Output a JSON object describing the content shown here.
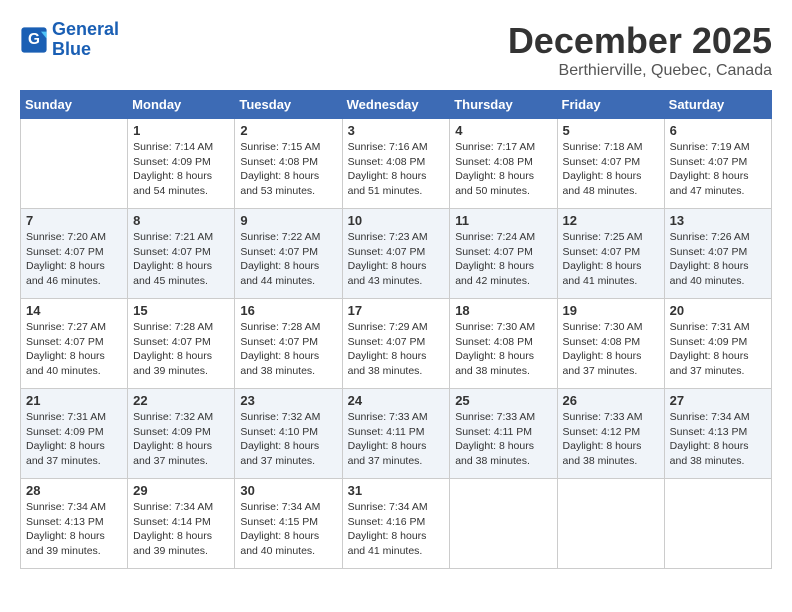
{
  "header": {
    "logo_line1": "General",
    "logo_line2": "Blue",
    "month": "December 2025",
    "location": "Berthierville, Quebec, Canada"
  },
  "weekdays": [
    "Sunday",
    "Monday",
    "Tuesday",
    "Wednesday",
    "Thursday",
    "Friday",
    "Saturday"
  ],
  "weeks": [
    [
      {
        "day": "",
        "sunrise": "",
        "sunset": "",
        "daylight": ""
      },
      {
        "day": "1",
        "sunrise": "Sunrise: 7:14 AM",
        "sunset": "Sunset: 4:09 PM",
        "daylight": "Daylight: 8 hours and 54 minutes."
      },
      {
        "day": "2",
        "sunrise": "Sunrise: 7:15 AM",
        "sunset": "Sunset: 4:08 PM",
        "daylight": "Daylight: 8 hours and 53 minutes."
      },
      {
        "day": "3",
        "sunrise": "Sunrise: 7:16 AM",
        "sunset": "Sunset: 4:08 PM",
        "daylight": "Daylight: 8 hours and 51 minutes."
      },
      {
        "day": "4",
        "sunrise": "Sunrise: 7:17 AM",
        "sunset": "Sunset: 4:08 PM",
        "daylight": "Daylight: 8 hours and 50 minutes."
      },
      {
        "day": "5",
        "sunrise": "Sunrise: 7:18 AM",
        "sunset": "Sunset: 4:07 PM",
        "daylight": "Daylight: 8 hours and 48 minutes."
      },
      {
        "day": "6",
        "sunrise": "Sunrise: 7:19 AM",
        "sunset": "Sunset: 4:07 PM",
        "daylight": "Daylight: 8 hours and 47 minutes."
      }
    ],
    [
      {
        "day": "7",
        "sunrise": "Sunrise: 7:20 AM",
        "sunset": "Sunset: 4:07 PM",
        "daylight": "Daylight: 8 hours and 46 minutes."
      },
      {
        "day": "8",
        "sunrise": "Sunrise: 7:21 AM",
        "sunset": "Sunset: 4:07 PM",
        "daylight": "Daylight: 8 hours and 45 minutes."
      },
      {
        "day": "9",
        "sunrise": "Sunrise: 7:22 AM",
        "sunset": "Sunset: 4:07 PM",
        "daylight": "Daylight: 8 hours and 44 minutes."
      },
      {
        "day": "10",
        "sunrise": "Sunrise: 7:23 AM",
        "sunset": "Sunset: 4:07 PM",
        "daylight": "Daylight: 8 hours and 43 minutes."
      },
      {
        "day": "11",
        "sunrise": "Sunrise: 7:24 AM",
        "sunset": "Sunset: 4:07 PM",
        "daylight": "Daylight: 8 hours and 42 minutes."
      },
      {
        "day": "12",
        "sunrise": "Sunrise: 7:25 AM",
        "sunset": "Sunset: 4:07 PM",
        "daylight": "Daylight: 8 hours and 41 minutes."
      },
      {
        "day": "13",
        "sunrise": "Sunrise: 7:26 AM",
        "sunset": "Sunset: 4:07 PM",
        "daylight": "Daylight: 8 hours and 40 minutes."
      }
    ],
    [
      {
        "day": "14",
        "sunrise": "Sunrise: 7:27 AM",
        "sunset": "Sunset: 4:07 PM",
        "daylight": "Daylight: 8 hours and 40 minutes."
      },
      {
        "day": "15",
        "sunrise": "Sunrise: 7:28 AM",
        "sunset": "Sunset: 4:07 PM",
        "daylight": "Daylight: 8 hours and 39 minutes."
      },
      {
        "day": "16",
        "sunrise": "Sunrise: 7:28 AM",
        "sunset": "Sunset: 4:07 PM",
        "daylight": "Daylight: 8 hours and 38 minutes."
      },
      {
        "day": "17",
        "sunrise": "Sunrise: 7:29 AM",
        "sunset": "Sunset: 4:07 PM",
        "daylight": "Daylight: 8 hours and 38 minutes."
      },
      {
        "day": "18",
        "sunrise": "Sunrise: 7:30 AM",
        "sunset": "Sunset: 4:08 PM",
        "daylight": "Daylight: 8 hours and 38 minutes."
      },
      {
        "day": "19",
        "sunrise": "Sunrise: 7:30 AM",
        "sunset": "Sunset: 4:08 PM",
        "daylight": "Daylight: 8 hours and 37 minutes."
      },
      {
        "day": "20",
        "sunrise": "Sunrise: 7:31 AM",
        "sunset": "Sunset: 4:09 PM",
        "daylight": "Daylight: 8 hours and 37 minutes."
      }
    ],
    [
      {
        "day": "21",
        "sunrise": "Sunrise: 7:31 AM",
        "sunset": "Sunset: 4:09 PM",
        "daylight": "Daylight: 8 hours and 37 minutes."
      },
      {
        "day": "22",
        "sunrise": "Sunrise: 7:32 AM",
        "sunset": "Sunset: 4:09 PM",
        "daylight": "Daylight: 8 hours and 37 minutes."
      },
      {
        "day": "23",
        "sunrise": "Sunrise: 7:32 AM",
        "sunset": "Sunset: 4:10 PM",
        "daylight": "Daylight: 8 hours and 37 minutes."
      },
      {
        "day": "24",
        "sunrise": "Sunrise: 7:33 AM",
        "sunset": "Sunset: 4:11 PM",
        "daylight": "Daylight: 8 hours and 37 minutes."
      },
      {
        "day": "25",
        "sunrise": "Sunrise: 7:33 AM",
        "sunset": "Sunset: 4:11 PM",
        "daylight": "Daylight: 8 hours and 38 minutes."
      },
      {
        "day": "26",
        "sunrise": "Sunrise: 7:33 AM",
        "sunset": "Sunset: 4:12 PM",
        "daylight": "Daylight: 8 hours and 38 minutes."
      },
      {
        "day": "27",
        "sunrise": "Sunrise: 7:34 AM",
        "sunset": "Sunset: 4:13 PM",
        "daylight": "Daylight: 8 hours and 38 minutes."
      }
    ],
    [
      {
        "day": "28",
        "sunrise": "Sunrise: 7:34 AM",
        "sunset": "Sunset: 4:13 PM",
        "daylight": "Daylight: 8 hours and 39 minutes."
      },
      {
        "day": "29",
        "sunrise": "Sunrise: 7:34 AM",
        "sunset": "Sunset: 4:14 PM",
        "daylight": "Daylight: 8 hours and 39 minutes."
      },
      {
        "day": "30",
        "sunrise": "Sunrise: 7:34 AM",
        "sunset": "Sunset: 4:15 PM",
        "daylight": "Daylight: 8 hours and 40 minutes."
      },
      {
        "day": "31",
        "sunrise": "Sunrise: 7:34 AM",
        "sunset": "Sunset: 4:16 PM",
        "daylight": "Daylight: 8 hours and 41 minutes."
      },
      {
        "day": "",
        "sunrise": "",
        "sunset": "",
        "daylight": ""
      },
      {
        "day": "",
        "sunrise": "",
        "sunset": "",
        "daylight": ""
      },
      {
        "day": "",
        "sunrise": "",
        "sunset": "",
        "daylight": ""
      }
    ]
  ]
}
